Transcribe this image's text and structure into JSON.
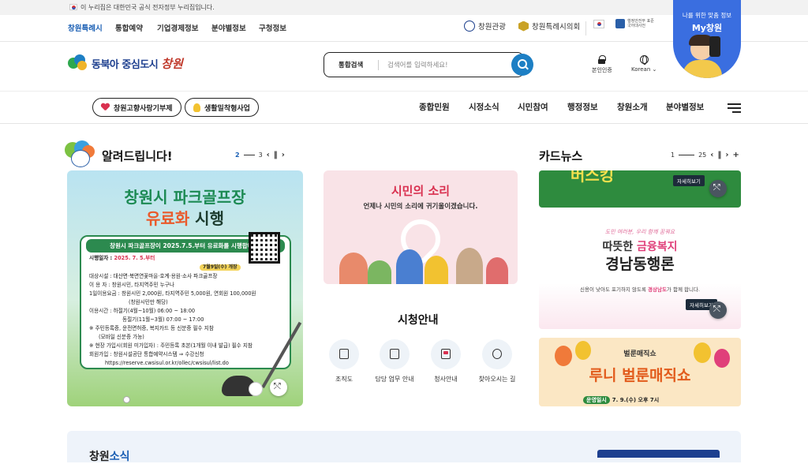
{
  "gov_bar": {
    "notice": "이 누리집은 대한민국 공식 전자정부 누리집입니다."
  },
  "top_nav": {
    "items": [
      "창원특례시",
      "통합예약",
      "기업경제정보",
      "분야별정보",
      "구청정보"
    ],
    "right": {
      "tourism": "창원관광",
      "council": "창원특례시의회"
    },
    "gov_logo_text": "행정안전부 표준국어대사전"
  },
  "promo": {
    "small": "나를 위한 맞춤 정보",
    "big": "My창원"
  },
  "header": {
    "logo_text": "동북아 중심도시",
    "logo_script": "창원",
    "search": {
      "label": "통합검색",
      "placeholder": "검색어를 입력하세요!"
    },
    "auth": "본인인증",
    "lang": "Korean"
  },
  "gnb": {
    "pill1": "창원고향사랑기부제",
    "pill2": "생활밀착형사업",
    "menu": [
      "종합민원",
      "시정소식",
      "시민참여",
      "행정정보",
      "창원소개",
      "분야별정보"
    ]
  },
  "notice_section": {
    "title": "알려드립니다!",
    "pager": {
      "current": "2",
      "total": "3"
    }
  },
  "banner": {
    "h1": "창원시 파크골프장",
    "h2a": "유료화",
    "h2b": " 시행",
    "card_title": "창원시 파크골프장이 2025.7.5.부터 유료화를 시행합니다!",
    "l1a": "시행일자 : ",
    "l1b": "2025. 7. 5.부터",
    "badge": "7월9일(수) 개장",
    "l2": "대상시설 : 대산면·북면연꽃마을·호계·용원·소사 파크골프장",
    "l3": "이 용 자 : 창원시민, 타지역주민 누구나",
    "l4": "1일이용요금 : 창원시민 2,000원, 타지역주민 5,000원, 연회원 100,000원",
    "l5": "(창원시민만 해당)",
    "l6": "이용시간 : 하절기(4월~10월) 06:00 ~ 18:00",
    "l7": "동절기(11월~3월) 07:00 ~ 17:00",
    "l8": "※ 주민등록증, 운전면허증, 복지카드 등 신분증 필수 지참",
    "l9": "(모바일 신분증 가능)",
    "l10": "※ 현장 가입시(회원 미가입자) : 주민등록 초본(1개월 이내 발급) 필수 지참",
    "l11": "회원가입 : 창원시설공단 통합예약시스템 ⇒ 수강신청",
    "l12": "https://reserve.cwsisul.or.kr/ollec/cwsisul/list.do"
  },
  "voice": {
    "title": "시민의 소리",
    "sub": "언제나 시민의 소리에 귀기울이겠습니다."
  },
  "guide": {
    "title": "시청안내",
    "items": [
      "조직도",
      "담당 업무 안내",
      "청사안내",
      "찾아오시는 길"
    ]
  },
  "card_news": {
    "title": "카드뉴스",
    "pager": {
      "current": "1",
      "total": "25"
    },
    "top": {
      "headline": "버스킹",
      "btn": "자세히보기"
    },
    "mid": {
      "s1": "도민 여러분, 우리 함께 꿈꿔요",
      "s2a": "따뜻한 ",
      "s2b": "금융복지",
      "s3": "경남동행론",
      "s4a": "신용이 낮아도 포기하지 않도록 ",
      "s4b": "경상남도",
      "s4c": "가 함께 합니다.",
      "btn": "자세히보기"
    },
    "bot": {
      "t1": "벌룬매직쇼",
      "t2": "루니 벌룬매직쇼",
      "date_label": "운영일시",
      "date": "7. 9.(수) 오후 7시"
    }
  },
  "bottom": {
    "t_a": "창원",
    "t_b": "소식"
  },
  "colors": {
    "accent": "#1a5fb4",
    "brand_red": "#d9304f",
    "green": "#2c8a4f"
  }
}
